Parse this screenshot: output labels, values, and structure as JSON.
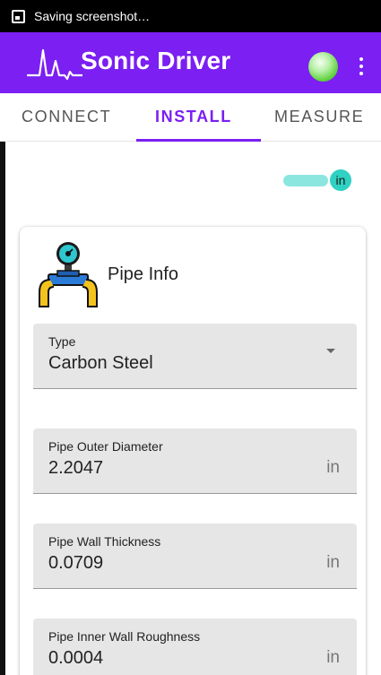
{
  "status_bar": {
    "text": "Saving screenshot…"
  },
  "app_bar": {
    "title": "Sonic Driver"
  },
  "tabs": [
    {
      "label": "CONNECT",
      "active": false
    },
    {
      "label": "INSTALL",
      "active": true
    },
    {
      "label": "MEASURE",
      "active": false
    }
  ],
  "unit_toggle": {
    "label": "in"
  },
  "pipe_info": {
    "title": "Pipe Info",
    "type": {
      "label": "Type",
      "value": "Carbon Steel"
    },
    "outer_diameter": {
      "label": "Pipe Outer Diameter",
      "value": "2.2047",
      "unit": "in"
    },
    "wall_thickness": {
      "label": "Pipe Wall Thickness",
      "value": "0.0709",
      "unit": "in"
    },
    "inner_roughness": {
      "label": "Pipe Inner Wall Roughness",
      "value": "0.0004",
      "unit": "in"
    }
  },
  "colors": {
    "primary": "#7b1ff2",
    "accent": "#2ed1c2",
    "status_ok": "#5fd13d"
  }
}
